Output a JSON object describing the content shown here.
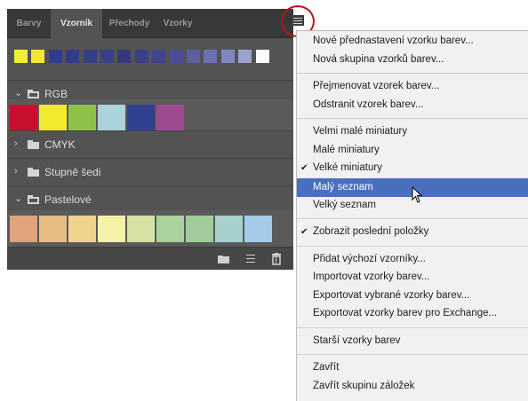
{
  "panel": {
    "tabs": [
      "Barvy",
      "Vzorník",
      "Přechody",
      "Vzorky"
    ],
    "active_tab": 1,
    "recent_swatches": [
      "#f1ee3a",
      "#f4e638",
      "#303a8e",
      "#333b8a",
      "#363e88",
      "#3a4089",
      "#34397f",
      "#3b3f87",
      "#40448e",
      "#4a4e96",
      "#5a5fa3",
      "#6a70b0",
      "#8088bf",
      "#9aa2ce",
      "#fbfbfb"
    ],
    "groups": [
      {
        "name": "RGB",
        "expanded": true,
        "swatches": [
          "#c80f2e",
          "#f2ea2e",
          "#8dc14a",
          "#acd2dd",
          "#303f8f",
          "#a04a93"
        ]
      },
      {
        "name": "CMYK",
        "expanded": false
      },
      {
        "name": "Stupně šedi",
        "expanded": false
      },
      {
        "name": "Pastelové",
        "expanded": true,
        "swatches": [
          "#e2a27b",
          "#e7bd84",
          "#eed48d",
          "#f6f2a6",
          "#d5e2a4",
          "#a9d29e",
          "#9fcc99",
          "#a7d1cf",
          "#a5cbea"
        ]
      }
    ],
    "bottom_icons": [
      "folder-icon",
      "list-icon",
      "trash-icon"
    ]
  },
  "menu": {
    "items": [
      {
        "label": "Nové přednastavení vzorku barev...",
        "checked": false
      },
      {
        "label": "Nová skupina vzorků barev...",
        "checked": false
      },
      {
        "sep": true
      },
      {
        "label": "Přejmenovat vzorek barev...",
        "checked": false
      },
      {
        "label": "Odstranit vzorek barev...",
        "checked": false
      },
      {
        "sep": true
      },
      {
        "label": "Velmi malé miniatury",
        "checked": false
      },
      {
        "label": "Malé miniatury",
        "checked": false
      },
      {
        "label": "Velké miniatury",
        "checked": true
      },
      {
        "label": "Malý seznam",
        "checked": false,
        "highlighted": true
      },
      {
        "label": "Velký seznam",
        "checked": false
      },
      {
        "sep": true
      },
      {
        "label": "Zobrazit poslední položky",
        "checked": true
      },
      {
        "sep": true
      },
      {
        "label": "Přidat výchozí vzorníky...",
        "checked": false
      },
      {
        "label": "Importovat vzorky barev...",
        "checked": false
      },
      {
        "label": "Exportovat vybrané vzorky barev...",
        "checked": false
      },
      {
        "label": "Exportovat vzorky barev pro Exchange...",
        "checked": false
      },
      {
        "sep": true
      },
      {
        "label": "Starší vzorky barev",
        "checked": false
      },
      {
        "sep": true
      },
      {
        "label": "Zavřít",
        "checked": false
      },
      {
        "label": "Zavřít skupinu záložek",
        "checked": false
      }
    ],
    "checkmark": "✔"
  },
  "colors": {
    "highlight": "#4a6fbf",
    "callout_ring": "#c0111b",
    "panel_bg": "#535353"
  }
}
